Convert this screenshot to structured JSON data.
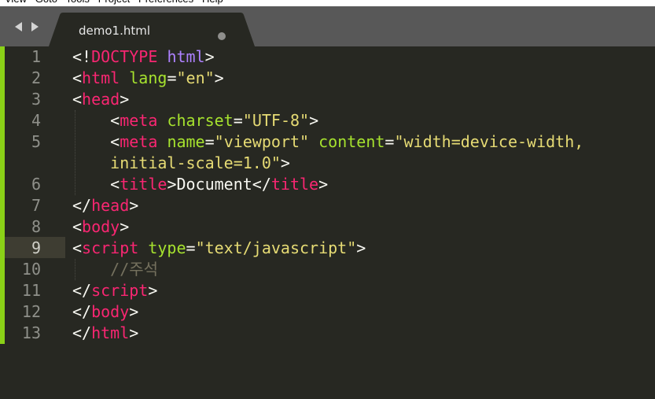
{
  "menu": {
    "items": [
      "View",
      "Goto",
      "Tools",
      "Project",
      "Preferences",
      "Help"
    ]
  },
  "tab": {
    "title": "demo1.html",
    "modified": true
  },
  "editor": {
    "active_line": 9,
    "lines": [
      {
        "number": "1",
        "tokens": [
          {
            "t": "<!",
            "c": "punc"
          },
          {
            "t": "DOCTYPE",
            "c": "tag"
          },
          {
            "t": " ",
            "c": "punc"
          },
          {
            "t": "html",
            "c": "kw"
          },
          {
            "t": ">",
            "c": "punc"
          }
        ]
      },
      {
        "number": "2",
        "tokens": [
          {
            "t": "<",
            "c": "punc"
          },
          {
            "t": "html",
            "c": "tag"
          },
          {
            "t": " ",
            "c": "punc"
          },
          {
            "t": "lang",
            "c": "attr"
          },
          {
            "t": "=",
            "c": "punc"
          },
          {
            "t": "\"en\"",
            "c": "str"
          },
          {
            "t": ">",
            "c": "punc"
          }
        ]
      },
      {
        "number": "3",
        "tokens": [
          {
            "t": "<",
            "c": "punc"
          },
          {
            "t": "head",
            "c": "tag"
          },
          {
            "t": ">",
            "c": "punc"
          }
        ]
      },
      {
        "number": "4",
        "tokens": [
          {
            "t": "    <",
            "c": "punc"
          },
          {
            "t": "meta",
            "c": "tag"
          },
          {
            "t": " ",
            "c": "punc"
          },
          {
            "t": "charset",
            "c": "attr"
          },
          {
            "t": "=",
            "c": "punc"
          },
          {
            "t": "\"UTF-8\"",
            "c": "str"
          },
          {
            "t": ">",
            "c": "punc"
          }
        ]
      },
      {
        "number": "5",
        "tokens": [
          {
            "t": "    <",
            "c": "punc"
          },
          {
            "t": "meta",
            "c": "tag"
          },
          {
            "t": " ",
            "c": "punc"
          },
          {
            "t": "name",
            "c": "attr"
          },
          {
            "t": "=",
            "c": "punc"
          },
          {
            "t": "\"viewport\"",
            "c": "str"
          },
          {
            "t": " ",
            "c": "punc"
          },
          {
            "t": "content",
            "c": "attr"
          },
          {
            "t": "=",
            "c": "punc"
          },
          {
            "t": "\"width=device-width,",
            "c": "str"
          }
        ]
      },
      {
        "number": "",
        "tokens": [
          {
            "t": "    ",
            "c": "punc"
          },
          {
            "t": "initial-scale=1.0\"",
            "c": "str"
          },
          {
            "t": ">",
            "c": "punc"
          }
        ]
      },
      {
        "number": "6",
        "tokens": [
          {
            "t": "    <",
            "c": "punc"
          },
          {
            "t": "title",
            "c": "tag"
          },
          {
            "t": ">Document</",
            "c": "punc"
          },
          {
            "t": "title",
            "c": "tag"
          },
          {
            "t": ">",
            "c": "punc"
          }
        ]
      },
      {
        "number": "7",
        "tokens": [
          {
            "t": "</",
            "c": "punc"
          },
          {
            "t": "head",
            "c": "tag"
          },
          {
            "t": ">",
            "c": "punc"
          }
        ]
      },
      {
        "number": "8",
        "tokens": [
          {
            "t": "<",
            "c": "punc"
          },
          {
            "t": "body",
            "c": "tag"
          },
          {
            "t": ">",
            "c": "punc"
          }
        ]
      },
      {
        "number": "9",
        "tokens": [
          {
            "t": "<",
            "c": "punc"
          },
          {
            "t": "script",
            "c": "tag"
          },
          {
            "t": " ",
            "c": "punc"
          },
          {
            "t": "type",
            "c": "attr"
          },
          {
            "t": "=",
            "c": "punc"
          },
          {
            "t": "\"text/javascript\"",
            "c": "str"
          },
          {
            "t": ">",
            "c": "punc"
          }
        ]
      },
      {
        "number": "10",
        "tokens": [
          {
            "t": "    ",
            "c": "punc"
          },
          {
            "t": "//주석",
            "c": "com"
          }
        ]
      },
      {
        "number": "11",
        "tokens": [
          {
            "t": "</",
            "c": "punc"
          },
          {
            "t": "script",
            "c": "tag"
          },
          {
            "t": ">",
            "c": "punc"
          }
        ]
      },
      {
        "number": "12",
        "tokens": [
          {
            "t": "</",
            "c": "punc"
          },
          {
            "t": "body",
            "c": "tag"
          },
          {
            "t": ">",
            "c": "punc"
          }
        ]
      },
      {
        "number": "13",
        "tokens": [
          {
            "t": "</",
            "c": "punc"
          },
          {
            "t": "html",
            "c": "tag"
          },
          {
            "t": ">",
            "c": "punc"
          }
        ]
      }
    ]
  },
  "colors": {
    "background": "#272822",
    "tabbar": "#585858",
    "gutter_marker": "#8ad117",
    "tag": "#f92672",
    "keyword": "#ae81ff",
    "attribute": "#a6e22e",
    "string": "#e6db74",
    "comment": "#75715e"
  },
  "icons": {
    "nav_back": "triangle-left-icon",
    "nav_forward": "triangle-right-icon",
    "unsaved": "dot-icon"
  }
}
